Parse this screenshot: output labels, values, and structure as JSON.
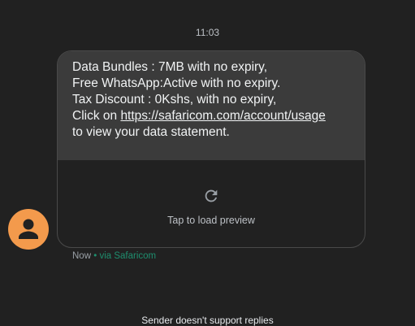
{
  "conversation": {
    "timestamp": "11:03",
    "message": {
      "line1": "Data Bundles : 7MB with no expiry,",
      "line2": "Free WhatsApp:Active with no expiry.",
      "line3": "Tax Discount : 0Kshs, with no expiry,",
      "line4_prefix": "Click on ",
      "link_text": "https://safaricom.com/account/usage",
      "line5": "to view your data statement."
    },
    "preview": {
      "label": "Tap to load preview",
      "icon": "refresh-icon"
    },
    "sender": {
      "avatar_icon": "person-icon",
      "avatar_color": "#f39a4c"
    },
    "meta": {
      "status": "Now",
      "separator": " • ",
      "via": "via Safaricom"
    },
    "footer_note": "Sender doesn't support replies"
  },
  "colors": {
    "background": "#212121",
    "bubble": "#3b3b3b",
    "via_accent": "#1e8e6e"
  }
}
